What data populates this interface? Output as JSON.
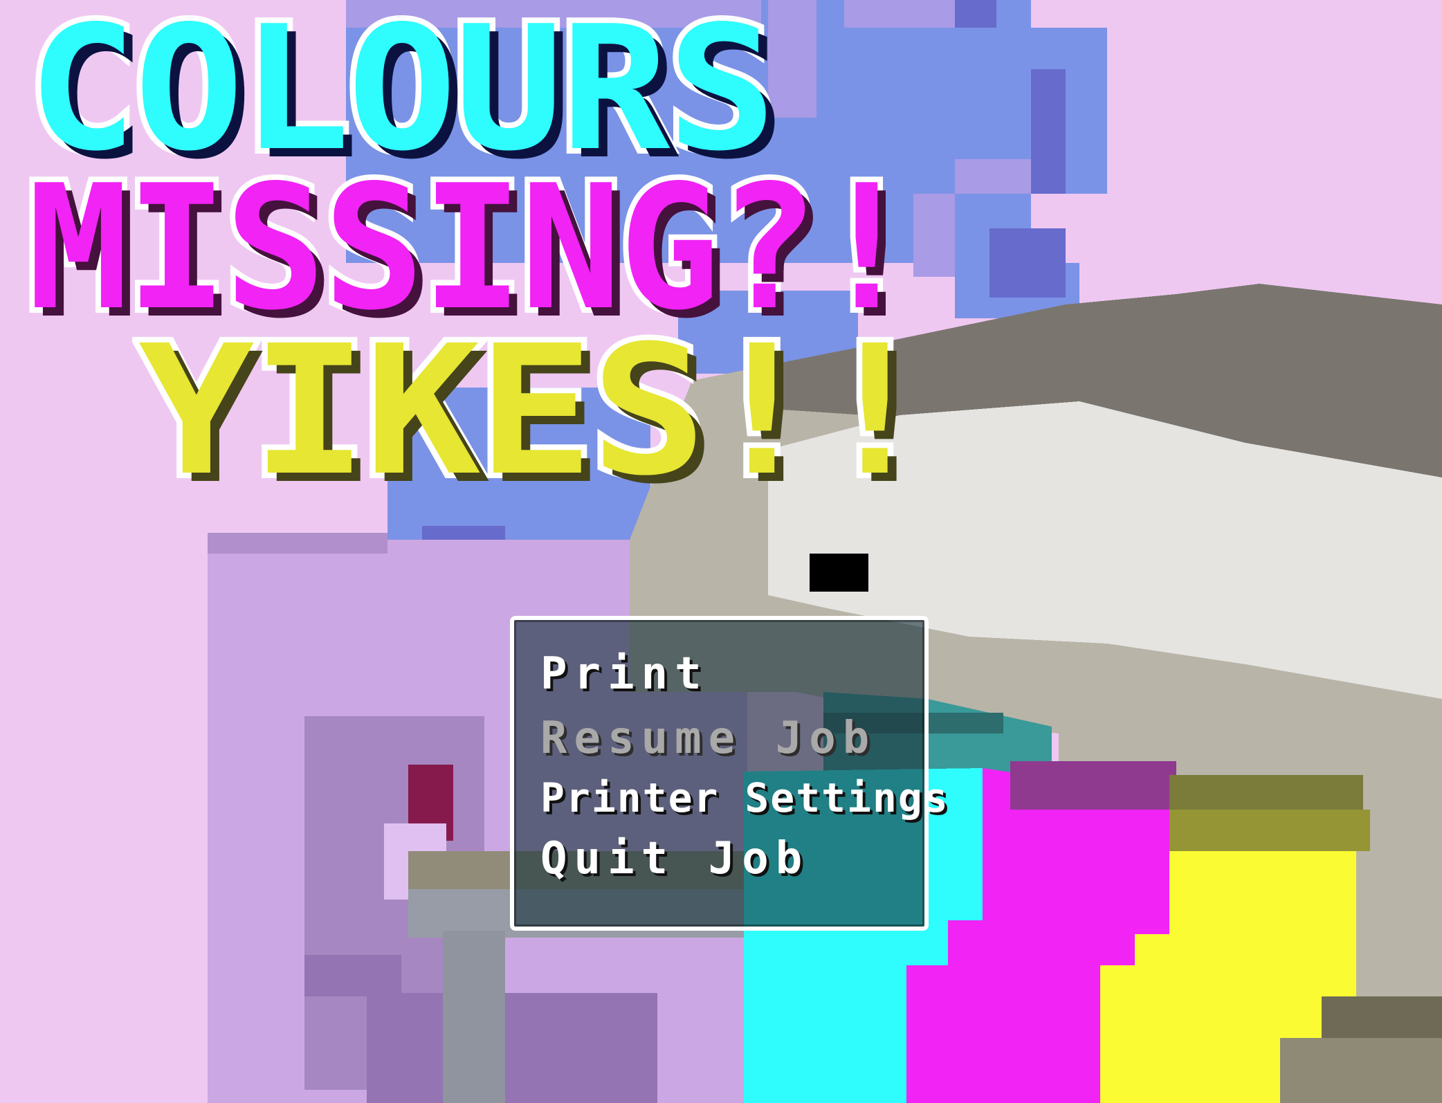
{
  "title": {
    "line1": "COLOURS",
    "line2": "MISSING?!",
    "line3": "YIKES!!"
  },
  "menu": {
    "items": [
      {
        "label": "Print",
        "state": "selected"
      },
      {
        "label": "Resume Job",
        "state": "disabled"
      },
      {
        "label": "Printer Settings",
        "state": "enabled"
      },
      {
        "label": "Quit Job",
        "state": "enabled"
      }
    ]
  },
  "colors": {
    "background": "#efc8f2",
    "cyan": "#2ffcfc",
    "magenta": "#f123f5",
    "yellow": "#fbfb33",
    "menu_border": "#ffffff"
  }
}
